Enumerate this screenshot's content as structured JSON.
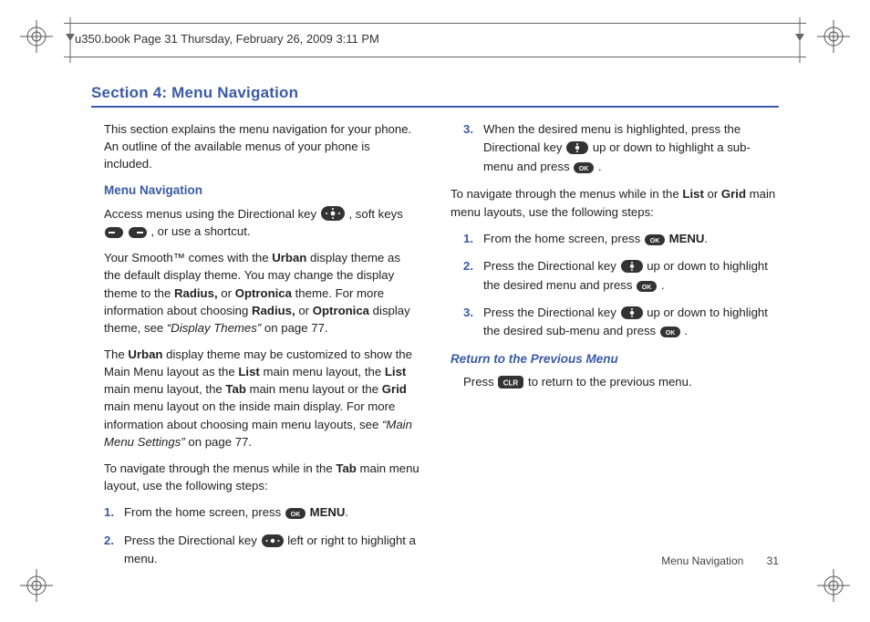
{
  "crop": {
    "fileinfo": "u350.book  Page 31  Thursday, February 26, 2009  3:11 PM"
  },
  "title": "Section 4: Menu Navigation",
  "left": {
    "p1": "This section explains the menu navigation for your phone. An outline of the available menus of your phone is included.",
    "h1": "Menu Navigation",
    "p2a": "Access menus using the Directional key ",
    "p2b": ", soft keys ",
    "p2c": ", or use a shortcut.",
    "p3a": "Your Smooth™ comes with the ",
    "p3b_bold": "Urban",
    "p3c": " display theme as the default display theme. You may change the display theme to the ",
    "p3d_bold": "Radius,",
    "p3e": " or ",
    "p3f_bold": "Optronica",
    "p3g": " theme. For more information about choosing ",
    "p3h_bold": "Radius,",
    "p3i": " or ",
    "p3j_bold": "Optronica",
    "p3k": " display theme, see ",
    "p3l_iq": "“Display Themes”",
    "p3m": " on page 77.",
    "p4a": "The ",
    "p4b_bold": "Urban",
    "p4c": " display theme may be customized to show the Main Menu layout as the ",
    "p4d_bold": "List",
    "p4e": " main menu layout, the ",
    "p4f_bold": "List",
    "p4g": " main menu layout, the ",
    "p4h_bold": "Tab",
    "p4i": " main menu layout or the ",
    "p4j_bold": "Grid",
    "p4k": " main menu layout on the inside main display. For more information about choosing main menu layouts, see ",
    "p4l_iq": "“Main Menu Settings”",
    "p4m": " on page 77.",
    "p5a": "To navigate through the menus while in the ",
    "p5b_bold": "Tab",
    "p5c": " main menu layout, use the following steps:",
    "steps": [
      {
        "n": "1.",
        "a": "From the home screen, press ",
        "b_bold": "MENU",
        "c": "."
      },
      {
        "n": "2.",
        "a": "Press the Directional key ",
        "b": " left or right to highlight a menu."
      }
    ]
  },
  "right": {
    "step3": {
      "n": "3.",
      "a": "When the desired menu is highlighted, press the Directional key ",
      "b": " up or down to highlight a sub-menu and press ",
      "c": "."
    },
    "p1a": "To navigate through the menus while in the ",
    "p1b_bold": "List",
    "p1c": " or ",
    "p1d_bold": "Grid",
    "p1e": " main menu layouts, use the following steps:",
    "steps": [
      {
        "n": "1.",
        "a": "From the home screen, press ",
        "b_bold": "MENU",
        "c": "."
      },
      {
        "n": "2.",
        "a": "Press the Directional key ",
        "b": " up or down to highlight the desired menu and press ",
        "c": "."
      },
      {
        "n": "3.",
        "a": "Press the Directional key ",
        "b": " up or down to highlight the desired sub-menu and press ",
        "c": "."
      }
    ],
    "h2": "Return to the Previous Menu",
    "p2a": "Press ",
    "p2b": " to return to the previous menu."
  },
  "footer": {
    "section": "Menu Navigation",
    "page": "31"
  }
}
